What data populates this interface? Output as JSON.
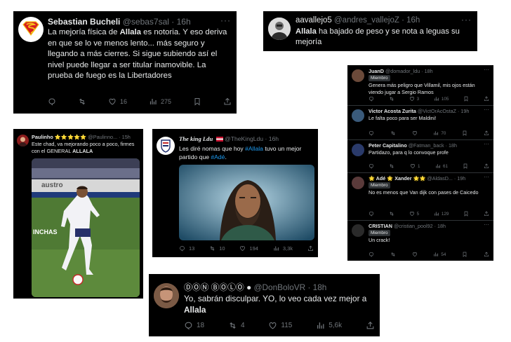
{
  "tweets": {
    "t1": {
      "name": "Sebastian Bucheli",
      "handle": "@sebas7sal",
      "time": "· 16h",
      "text_a": "La mejoría física de ",
      "mention": "Allala",
      "text_b": " es notoria. Y eso deriva en que se lo ve menos lento... más seguro y llegando a más cierres. Si sigue subiendo así el nivel puede llegar a ser titular inamovible. La prueba de fuego es la Libertadores",
      "likes": "16",
      "views": "275",
      "more": "···"
    },
    "t2": {
      "name": "aavallejo5",
      "handle": "@andres_vallejoZ",
      "time": "· 16h",
      "mention": "Allala",
      "text": " ha bajado de peso y se nota a leguas su mejoría",
      "more": "···"
    },
    "t3": {
      "name": "Paulinho ⭐⭐⭐⭐⭐",
      "handle": "@Paulinno...",
      "time": "· 15h",
      "text": "Este chad, va mejorando poco a poco, firmes con el GENERAL ",
      "mention": "ALLALA",
      "more": "···",
      "photo_banner": "austro",
      "photo_ad": "INCHAS"
    },
    "t4": {
      "name": "The king Ldu",
      "handle": "@TheKingLdu",
      "time": "· 16h",
      "text_a": "Les diré nomas que hoy ",
      "hashtag1": "#Allala",
      "text_b": " tuvo un mejor partido que ",
      "hashtag2": "#Adé",
      "text_c": ".",
      "replies": "13",
      "retweets": "10",
      "likes": "194",
      "views": "3,3k",
      "more": "···"
    },
    "t5": {
      "name": "ⒹⓄⓃ ⒷⓄⓁⓄ ",
      "handle": "@DonBoloVR",
      "time": "· 18h",
      "text": "Yo, sabrán disculpar. YO, lo veo cada vez mejor a ",
      "mention": "Allala",
      "replies": "18",
      "retweets": "4",
      "likes": "115",
      "views": "5,6k",
      "more": "···"
    }
  },
  "replies": {
    "badge": "Miembro",
    "items": [
      {
        "name": "JuanD",
        "handle": "@domador_ldu",
        "time": "· 18h",
        "text": "Genera más peligro que Villamil, mis ojos están viendo jugar a Sergio Ramos",
        "replies": "",
        "retweets": "",
        "likes": "3",
        "views": "105",
        "member": true
      },
      {
        "name": "Victor Acosta Zurita",
        "handle": "@VictOrAcOstaZ",
        "time": "· 19h",
        "text": "Le falta poco para ser Maldini!",
        "replies": "",
        "retweets": "",
        "likes": "",
        "views": "70",
        "member": false
      },
      {
        "name": "Peter Capitalino",
        "handle": "@Fatman_back",
        "time": "· 18h",
        "text": "Partidazo, para q lo convoque profe",
        "replies": "",
        "retweets": "",
        "likes": "1",
        "views": "61",
        "member": false
      },
      {
        "name": "🌟 Adé 🌟 Xander 🌟🌟",
        "handle": "@AldasD...",
        "time": "· 19h",
        "text": "No es menos que Van dijk con pases de Caicedo",
        "replies": "",
        "retweets": "",
        "likes": "5",
        "views": "129",
        "member": true
      },
      {
        "name": "CRISTIAN",
        "handle": "@cristian_pool92",
        "time": "· 18h",
        "text": "Un crack!",
        "replies": "",
        "retweets": "",
        "likes": "",
        "views": "54",
        "member": true
      }
    ]
  },
  "colors": {
    "bg": "#000000",
    "text": "#e7e9ea",
    "muted": "#71767b",
    "link": "#1d9bf0",
    "border": "#2f3336"
  }
}
